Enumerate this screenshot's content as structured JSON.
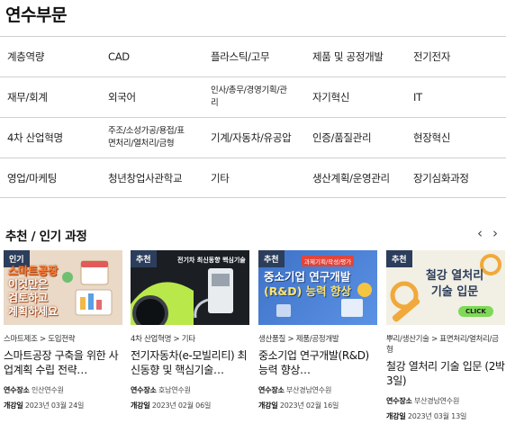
{
  "section_title": "연수부문",
  "categories": [
    [
      "계층역량",
      "CAD",
      "플라스틱/고무",
      "제품 및 공정개발",
      "전기전자"
    ],
    [
      "재무/회계",
      "외국어",
      "인사/총무/경영기획/관리",
      "자기혁신",
      "IT"
    ],
    [
      "4차 산업혁명",
      "주조/소성가공/용접/표면처리/열처리/금형",
      "기계/자동차/유공압",
      "인증/품질관리",
      "현장혁신"
    ],
    [
      "영업/마케팅",
      "청년창업사관학교",
      "기타",
      "생산계획/운영관리",
      "장기심화과정"
    ]
  ],
  "recommend_title": "추천 / 인기 과정",
  "arrows": {
    "prev": "‹",
    "next": "›"
  },
  "cards": [
    {
      "badge": "인기",
      "thumb_lines": [
        "스마트공장",
        "이것만은",
        "검토하고",
        "계획하세요"
      ],
      "crumb": "스마트제조 > 도입전략",
      "title": "스마트공장 구축을 위한 사업계획 수립 전략…",
      "place_label": "연수장소",
      "place": "인산연수원",
      "date_label": "개강일",
      "date": "2023년 03월 24일"
    },
    {
      "badge": "추천",
      "thumb_lines": [
        "전기차 최신동향 핵심기술"
      ],
      "crumb": "4차 산업혁명 > 기타",
      "title": "전기자동차(e-모빌리티) 최신동향 및 핵심기술…",
      "place_label": "연수장소",
      "place": "호남연수원",
      "date_label": "개강일",
      "date": "2023년 02월 06일"
    },
    {
      "badge": "추천",
      "thumb_lines": [
        "과제기획/작성/평가",
        "중소기업 연구개발",
        "(R&D) 능력 향상"
      ],
      "crumb": "생산품질 > 제품/공정개발",
      "title": "중소기업 연구개발(R&D) 능력 향상…",
      "place_label": "연수장소",
      "place": "부산경남연수원",
      "date_label": "개강일",
      "date": "2023년 02월 16일"
    },
    {
      "badge": "추천",
      "thumb_lines": [
        "철강 열처리",
        "기술 입문",
        "CLICK"
      ],
      "crumb": "뿌리/생산기술 > 표면처리/열처리/금형",
      "title": "철강 열처리 기술 입문 (2박3일)",
      "place_label": "연수장소",
      "place": "부산경남연수원",
      "date_label": "개강일",
      "date": "2023년 03월 13일"
    }
  ]
}
